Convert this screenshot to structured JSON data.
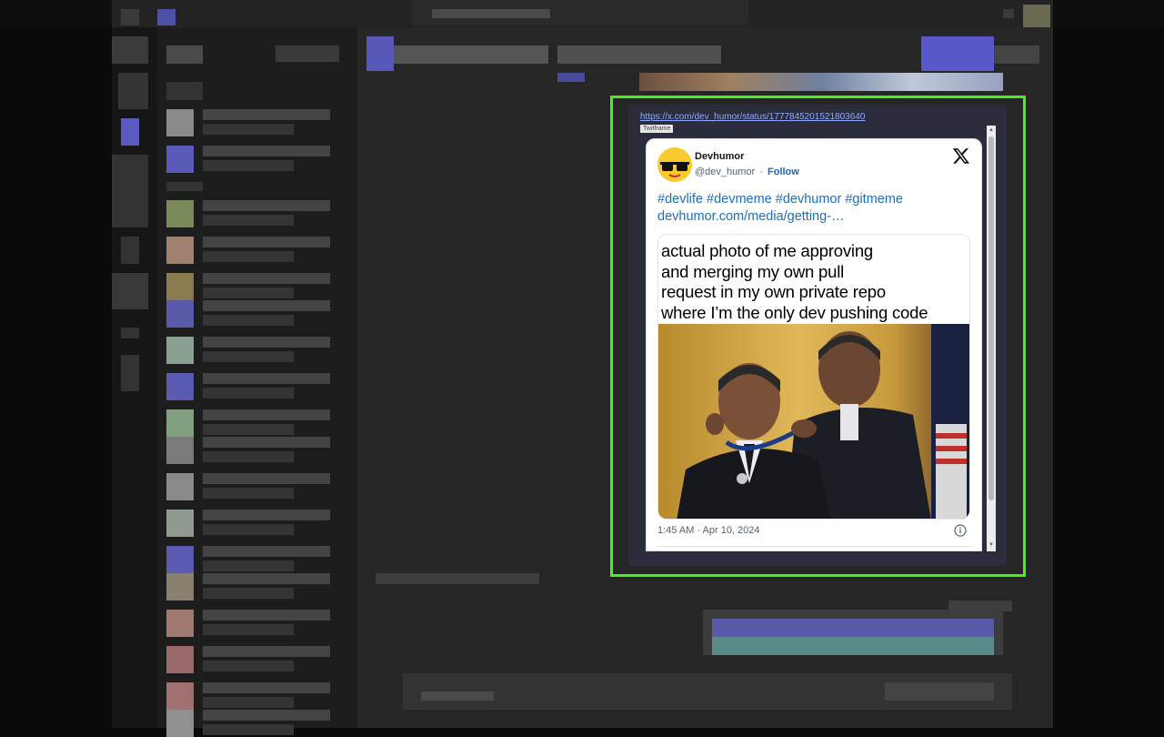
{
  "embed": {
    "url": "https://x.com/dev_humor/status/1777845201521803640",
    "badge": "Twitframe"
  },
  "tweet": {
    "name": "Devhumor",
    "handle": "@dev_humor",
    "separator": "·",
    "follow_label": "Follow",
    "text_line1": "#devlife #devmeme #devhumor #gitmeme",
    "text_line2": "devhumor.com/media/getting-…",
    "meme_caption": [
      "actual photo of me approving",
      "and merging my own pull",
      "request in my own private repo",
      "where I’m the only dev pushing code"
    ],
    "timestamp": "1:45 AM · Apr 10, 2024"
  },
  "colors": {
    "highlight": "#45f21c",
    "link": "#1d6fbf",
    "embed_bg": "#2b2d3c"
  },
  "icons": {
    "logo": "x-logo-icon",
    "info": "info-icon",
    "avatar": "sunglasses-face-icon"
  }
}
